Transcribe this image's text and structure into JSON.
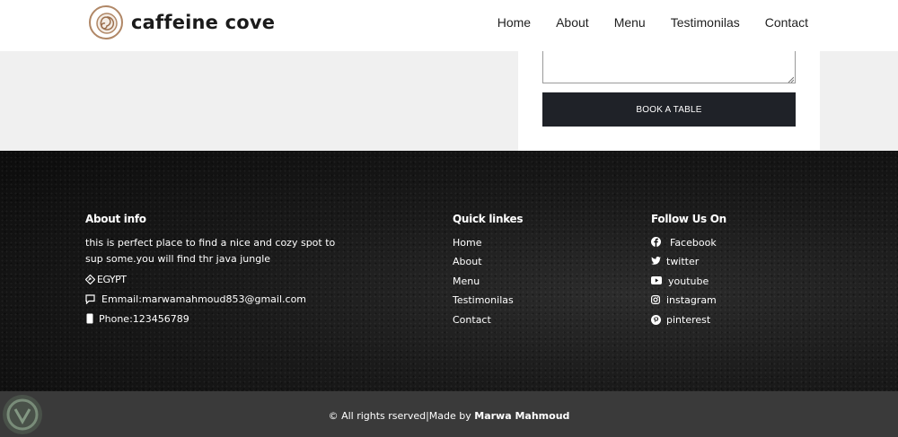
{
  "header": {
    "brand": "caffeine cove",
    "nav": [
      "Home",
      "About",
      "Menu",
      "Testimonilas",
      "Contact"
    ]
  },
  "booking": {
    "button_label": "BOOK A TABLE"
  },
  "footer": {
    "about": {
      "title": "About info",
      "desc_line1": "this is perfect place to find a nice and cozy spot to",
      "desc_line2": "sup some.you will find thr java jungle",
      "country": "EGYPT",
      "email": "Emmail:marwamahmoud853@gmail.com",
      "phone": "Phone:123456789"
    },
    "quick": {
      "title": "Quick linkes",
      "links": [
        "Home",
        "About",
        "Menu",
        "Testimonilas",
        "Contact"
      ]
    },
    "follow": {
      "title": "Follow Us On",
      "links": [
        "Facebook",
        "twitter",
        "youtube",
        "instagram",
        "pinterest"
      ]
    }
  },
  "bottom": {
    "copyright": "© All rights rserved|Made by ",
    "author": "Marwa Mahmoud"
  },
  "colors": {
    "header_bg": "#ffffff",
    "band_bg": "#f0f0f0",
    "button_bg": "#1f2228",
    "bottom_bg": "#3a3a3a",
    "logo_accent": "#b08766"
  }
}
